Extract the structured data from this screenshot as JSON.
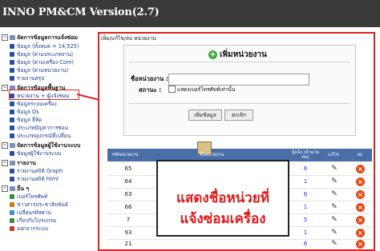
{
  "app": {
    "title": "INNO PM&CM Version(2.7)"
  },
  "sidebar": {
    "sections": [
      {
        "title": "จัดการข้อมูลการแจ้งซ่อม",
        "items": [
          "ข้อมูล (ทั้งหมด = 14,525)",
          "ข้อมูล (ตามประเภทงาน)",
          "ข้อมูล (ตามเครื่อง Com)",
          "ข้อมูล (ตามหน่วยงาน)",
          "รายงานสรุป"
        ]
      },
      {
        "title": "จัดการข้อมูลพื้นฐาน",
        "items": [
          "หน่วยงาน + ผู้แจ้งซ่อม",
          "ข้อมูลระบบเครื่อง",
          "ข้อมูล Os",
          "ข้อมูล ยี่ห้อ",
          "ประเภทปัญหาการซ่อม",
          "ประเภทอุปกรณ์ที่เปลี่ยน"
        ]
      },
      {
        "title": "จัดการข้อมูลผู้ใช้งานระบบ",
        "items": [
          "ข้อมูลผู้ใช้งานระบบ"
        ]
      },
      {
        "title": "รายงาน",
        "items": [
          "รายงานสถิติ Graph",
          "รายงานสถิติ html"
        ]
      },
      {
        "title": "อื่น ๆ",
        "items": [
          "เบอร์โทรศัพท์",
          "ข่าวสารประชาสัมพันธ์",
          "เปลี่ยนรหัสผ่าน",
          "เกี่ยวกับโปรแกรม",
          "ออกจากระบบ"
        ]
      }
    ]
  },
  "main": {
    "breadcrumb": "เพิ่ม/แก้ไข/ลบ หน่วยงาน",
    "form": {
      "title": "เพิ่มหน่วยงาน",
      "name_label": "ชื่อหน่วยงาน :",
      "name_value": "",
      "status_label": "สถานะ :",
      "status_checkbox_label": "แสดงเบอร์โทรศัพท์เท่านั้น",
      "add_button": "เพิ่มข้อมูล",
      "cancel_button": "ยกเลิก"
    },
    "table": {
      "headers": {
        "code": "รหัสหน่วยงาน",
        "name": "ชื่อหน่วยงาน",
        "count": "ผู้แจ้ง (จำนวนคน)",
        "edit": "แก้ไข",
        "delete": "ลบ"
      },
      "rows": [
        {
          "code": "65",
          "count": "6"
        },
        {
          "code": "64",
          "count": "1"
        },
        {
          "code": "63",
          "count": "6"
        },
        {
          "code": "66",
          "count": "1"
        },
        {
          "code": "7",
          "count": "5"
        },
        {
          "code": "93",
          "count": "1"
        },
        {
          "code": "21",
          "count": "6"
        }
      ]
    },
    "annotation": {
      "line1": "แสดงชื่อหน่วยที่",
      "line2": "แจ้งซ่อมเครื่อง"
    }
  }
}
